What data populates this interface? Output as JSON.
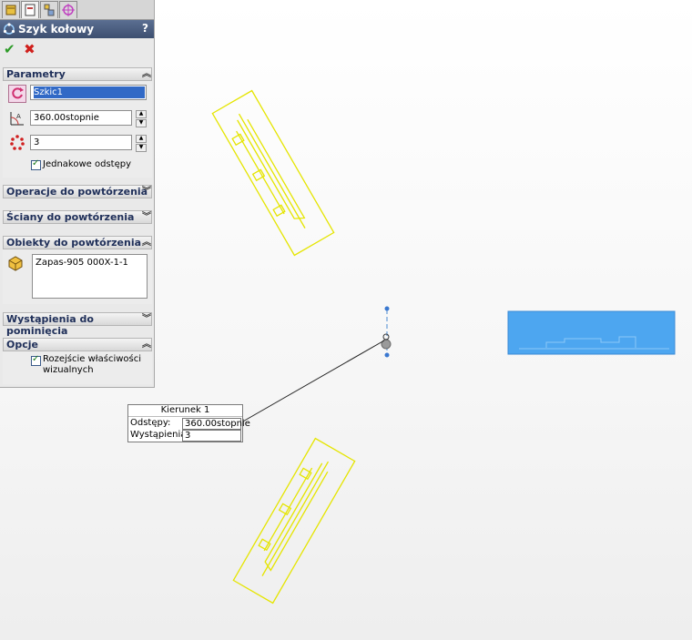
{
  "tabs": [
    {
      "name": "feature-manager-tab-icon"
    },
    {
      "name": "property-manager-tab-icon"
    },
    {
      "name": "configuration-manager-tab-icon"
    },
    {
      "name": "dimxpert-tab-icon"
    }
  ],
  "panel": {
    "title": "Szyk kołowy",
    "help": "?",
    "ok_icon": "✔",
    "cancel_icon": "✖"
  },
  "sections": {
    "parametry": {
      "label": "Parametry",
      "axis_value": "Szkic1",
      "angle_value": "360.00stopnie",
      "instances_value": "3",
      "equal_spacing_label": "Jednakowe odstępy",
      "equal_spacing_checked": true
    },
    "operacje": {
      "label": "Operacje do powtórzenia"
    },
    "sciany": {
      "label": "Ściany do powtórzenia"
    },
    "obiekty": {
      "label": "Obiekty do powtórzenia",
      "items": [
        "Zapas-905 000X-1-1"
      ]
    },
    "wystapienia": {
      "label": "Wystąpienia do pominięcia"
    },
    "opcje": {
      "label": "Opcje",
      "propagate_label": "Rozejście właściwości wizualnych",
      "propagate_label_line1": "Rozejście właściwości",
      "propagate_label_line2": "wizualnych",
      "propagate_checked": true
    }
  },
  "callout": {
    "title": "Kierunek 1",
    "spacing_label": "Odstępy:",
    "spacing_value": "360.00stopnie",
    "instances_label": "Wystąpienia:",
    "instances_value": "3"
  },
  "colors": {
    "preview": "#e8e800",
    "part": "#4da6f0",
    "title_bar": "#44567a"
  }
}
